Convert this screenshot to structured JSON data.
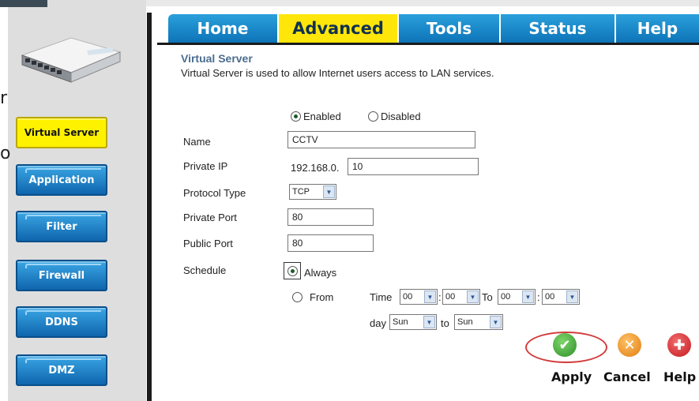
{
  "tabs": [
    {
      "label": "Home"
    },
    {
      "label": "Advanced"
    },
    {
      "label": "Tools"
    },
    {
      "label": "Status"
    },
    {
      "label": "Help"
    }
  ],
  "sidebar": {
    "items": [
      {
        "label": "Virtual Server"
      },
      {
        "label": "Application"
      },
      {
        "label": "Filter"
      },
      {
        "label": "Firewall"
      },
      {
        "label": "DDNS"
      },
      {
        "label": "DMZ"
      }
    ],
    "stray_chars": [
      "r",
      "o"
    ]
  },
  "section": {
    "title": "Virtual Server",
    "description": "Virtual Server is used to allow Internet users access to LAN services."
  },
  "form": {
    "enabled_label": "Enabled",
    "disabled_label": "Disabled",
    "name_label": "Name",
    "name_value": "CCTV",
    "private_ip_label": "Private IP",
    "private_ip_prefix": "192.168.0.",
    "private_ip_value": "10",
    "protocol_label": "Protocol Type",
    "protocol_value": "TCP",
    "private_port_label": "Private Port",
    "private_port_value": "80",
    "public_port_label": "Public Port",
    "public_port_value": "80",
    "schedule_label": "Schedule",
    "always_label": "Always",
    "from_label": "From",
    "time_label": "Time",
    "to_label": "To",
    "time_from_hour": "00",
    "time_from_min": "00",
    "time_to_hour": "00",
    "time_to_min": "00",
    "day_label": "day",
    "day_to_label": "to",
    "day_from": "Sun",
    "day_to": "Sun"
  },
  "actions": {
    "apply_label": "Apply",
    "cancel_label": "Cancel",
    "help_label": "Help"
  },
  "colors": {
    "tab_blue": "#1a8ad0",
    "tab_active": "#ffe60a",
    "sidebar_active": "#fff200",
    "apply_green": "#3aa635",
    "cancel_orange": "#f08a1c",
    "help_red": "#d8232a",
    "highlight_red": "#d23b3b"
  }
}
